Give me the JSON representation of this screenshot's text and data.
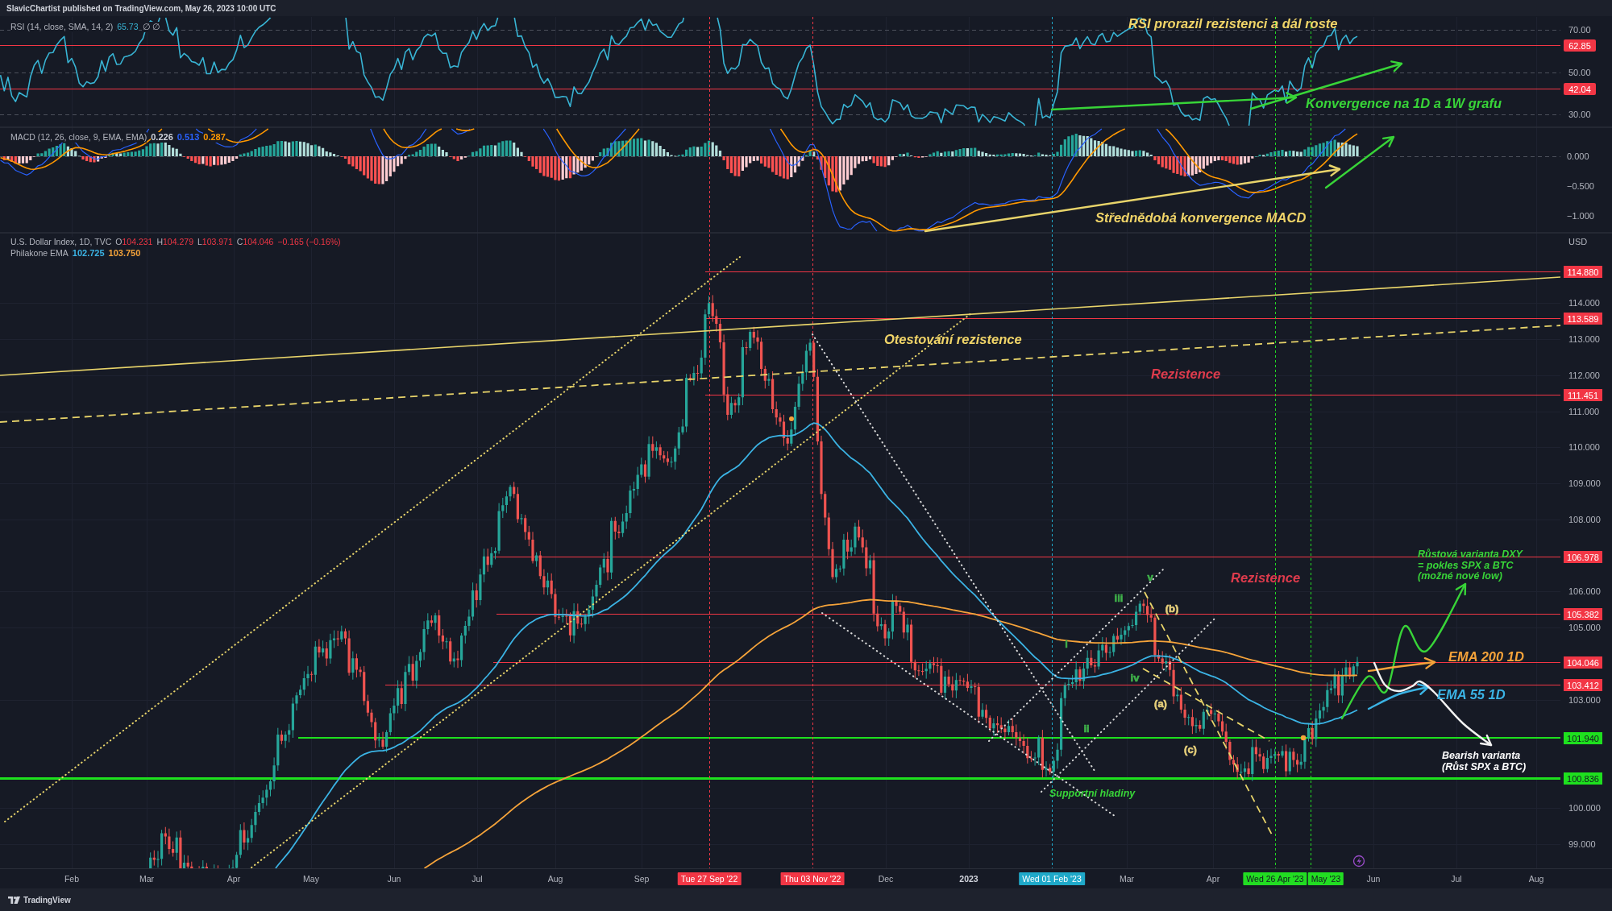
{
  "header": {
    "text": "SlavicChartist published on TradingView.com, May 26, 2023 10:00 UTC"
  },
  "rsi_pane": {
    "legend": {
      "title": "RSI (14, close, SMA, 14, 2)",
      "value": "65.73",
      "extra": "∅ ∅"
    },
    "axis": [
      {
        "text": "70.00",
        "kind": "tick"
      },
      {
        "text": "62.85",
        "kind": "badge"
      },
      {
        "text": "50.00",
        "kind": "tick"
      },
      {
        "text": "42.04",
        "kind": "badge"
      },
      {
        "text": "30.00",
        "kind": "tick"
      }
    ],
    "annotations": [
      {
        "text": "RSI prorazil rezistenci a dál roste",
        "color": "#f0d468",
        "kind": "callout"
      },
      {
        "text": "Konvergence na 1D a 1W grafu",
        "color": "#38d438",
        "kind": "callout"
      }
    ]
  },
  "macd_pane": {
    "legend": {
      "title": "MACD (12, 26, close, 9, EMA, EMA)",
      "values": [
        {
          "text": "0.226",
          "color": "#d1d4dc"
        },
        {
          "text": "0.513",
          "color": "#2962ff"
        },
        {
          "text": "0.287",
          "color": "#ff9800"
        }
      ]
    },
    "axis": [
      "0.000",
      "−0.500",
      "−1.000"
    ],
    "annotations": [
      {
        "text": "Střednědobá konvergence MACD",
        "color": "#f0d468",
        "kind": "callout"
      }
    ]
  },
  "price_pane": {
    "legend": {
      "title": "U.S. Dollar Index, 1D, TVC",
      "ohlc": [
        {
          "label": "O",
          "value": "104.231"
        },
        {
          "label": "H",
          "value": "104.279"
        },
        {
          "label": "L",
          "value": "103.971"
        },
        {
          "label": "C",
          "value": "104.046"
        }
      ],
      "change": "−0.165 (−0.16%)"
    },
    "ema_legend": {
      "title": "Philakone EMA",
      "values": [
        {
          "text": "102.725",
          "color": "#3bb3e4"
        },
        {
          "text": "103.750",
          "color": "#f5a33a"
        }
      ]
    },
    "currency": "USD",
    "ticks": [
      "114.000",
      "113.000",
      "112.000",
      "111.000",
      "110.000",
      "109.000",
      "108.000",
      "106.000",
      "105.000",
      "103.000",
      "100.000",
      "99.000"
    ],
    "levels": [
      {
        "text": "114.880",
        "color": "#f23645"
      },
      {
        "text": "113.589",
        "color": "#f23645"
      },
      {
        "text": "111.451",
        "color": "#f23645"
      },
      {
        "text": "106.978",
        "color": "#f23645"
      },
      {
        "text": "105.382",
        "color": "#f23645"
      },
      {
        "text": "104.046",
        "color": "#f23645"
      },
      {
        "text": "103.412",
        "color": "#f23645"
      },
      {
        "text": "101.940",
        "color": "#1ee01e"
      },
      {
        "text": "100.836",
        "color": "#1ee01e"
      }
    ],
    "annotations": [
      {
        "text": "Otestování rezistence",
        "color": "#f0d468",
        "kind": "callout"
      },
      {
        "text": "Rezistence",
        "color": "#dd3b4c",
        "kind": "callout"
      },
      {
        "text": "Rezistence",
        "color": "#dd3b4c",
        "kind": "callout"
      },
      {
        "lines": [
          "Růstová varianta DXY",
          "= pokles SPX a BTC",
          "(možné nové low)"
        ],
        "color": "#38d438",
        "kind": "note"
      },
      {
        "text": "EMA 200 1D",
        "color": "#f5a33a",
        "kind": "callout"
      },
      {
        "text": "EMA 55 1D",
        "color": "#3bb3e4",
        "kind": "callout"
      },
      {
        "lines": [
          "Bearish varianta",
          "(Růst SPX a BTC)"
        ],
        "color": "#ffffff",
        "kind": "note"
      },
      {
        "text": "Supportní hladiny",
        "color": "#38d438",
        "kind": "note"
      }
    ],
    "wave_labels": [
      {
        "text": "v",
        "color": "#3fb24a"
      },
      {
        "text": "iii",
        "color": "#3fb24a"
      },
      {
        "text": "i",
        "color": "#3fb24a"
      },
      {
        "text": "iv",
        "color": "#3fb24a"
      },
      {
        "text": "ii",
        "color": "#3fb24a"
      },
      {
        "text": "(b)",
        "color": "#e6cf7a"
      },
      {
        "text": "(a)",
        "color": "#e6cf7a"
      },
      {
        "text": "(c)",
        "color": "#e6cf7a"
      }
    ]
  },
  "time_axis": [
    {
      "text": "Feb",
      "kind": "month"
    },
    {
      "text": "Mar",
      "kind": "month"
    },
    {
      "text": "Apr",
      "kind": "month"
    },
    {
      "text": "May",
      "kind": "month"
    },
    {
      "text": "Jun",
      "kind": "month"
    },
    {
      "text": "Jul",
      "kind": "month"
    },
    {
      "text": "Aug",
      "kind": "month"
    },
    {
      "text": "Sep",
      "kind": "month"
    },
    {
      "text": "Tue 27 Sep '22",
      "kind": "marker",
      "color": "#f23645"
    },
    {
      "text": "Thu 03 Nov '22",
      "kind": "marker",
      "color": "#f23645"
    },
    {
      "text": "Dec",
      "kind": "month"
    },
    {
      "text": "2023",
      "kind": "year"
    },
    {
      "text": "Wed 01 Feb '23",
      "kind": "marker",
      "color": "#1fa9c9"
    },
    {
      "text": "Mar",
      "kind": "month"
    },
    {
      "text": "Apr",
      "kind": "month"
    },
    {
      "text": "Wed 26 Apr '23",
      "kind": "marker",
      "color": "#22dd22"
    },
    {
      "text": "May '23",
      "kind": "marker",
      "color": "#22dd22"
    },
    {
      "text": "Jun",
      "kind": "month"
    },
    {
      "text": "Jul",
      "kind": "month"
    },
    {
      "text": "Aug",
      "kind": "month"
    }
  ],
  "footer": {
    "brand": "TradingView"
  }
}
